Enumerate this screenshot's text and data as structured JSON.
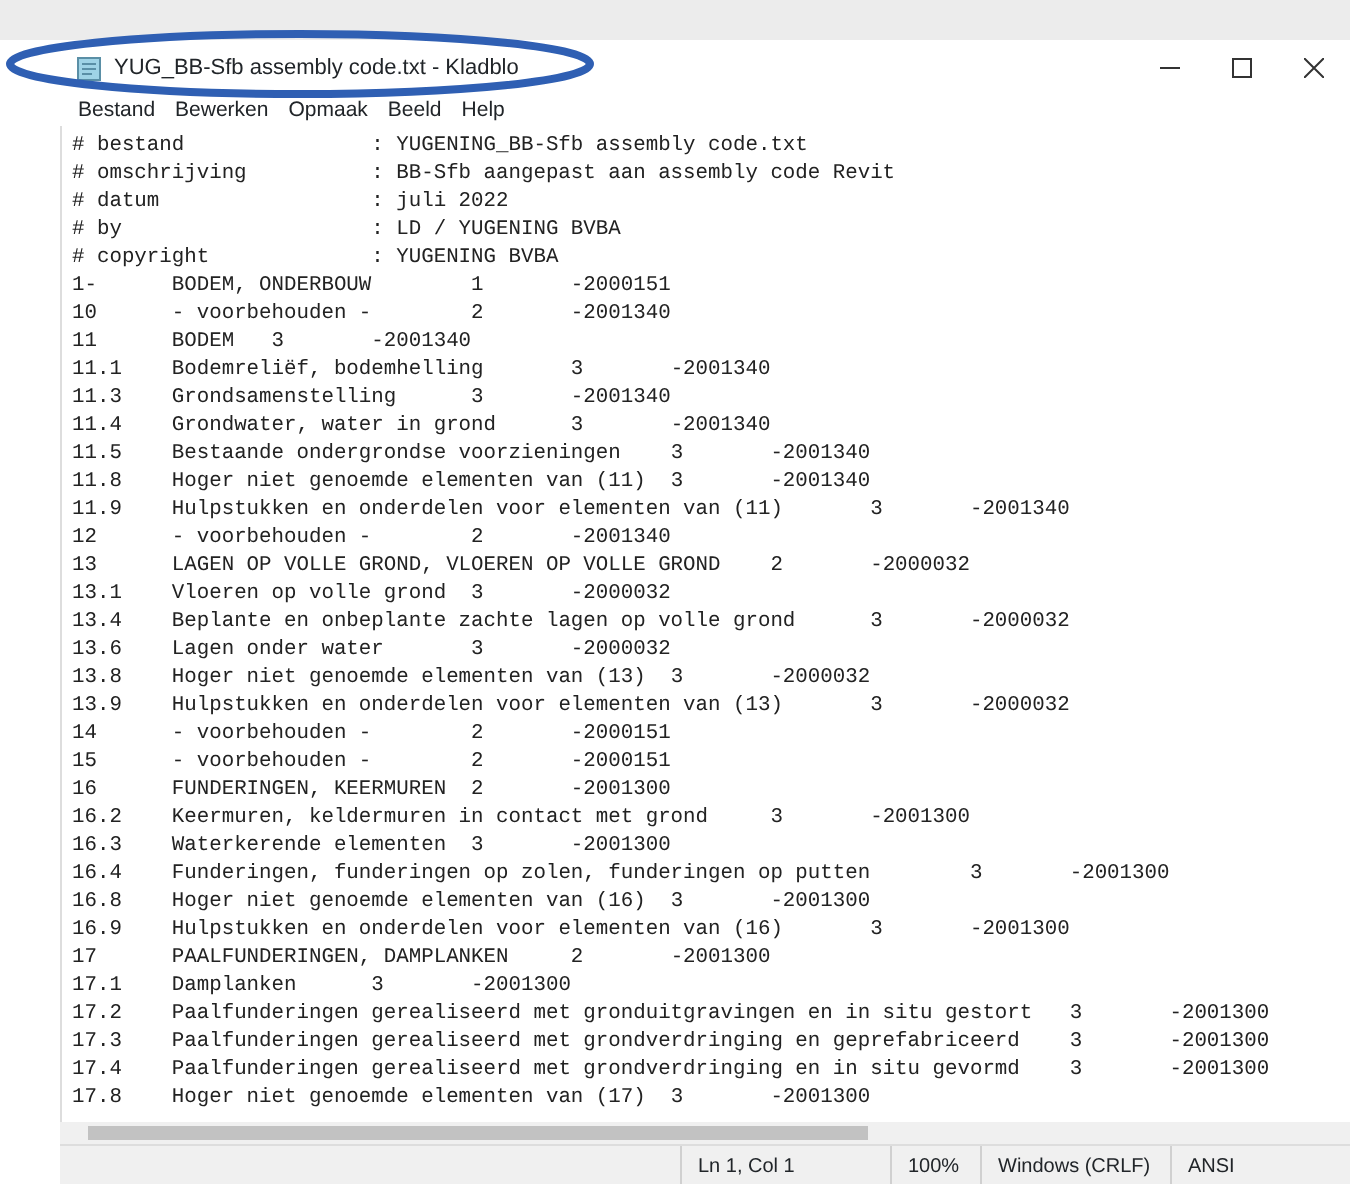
{
  "window": {
    "title": "YUG_BB-Sfb assembly code.txt - Kladblo"
  },
  "menu": [
    "Bestand",
    "Bewerken",
    "Opmaak",
    "Beeld",
    "Help"
  ],
  "lines": [
    "# bestand\t\t: YUGENING_BB-Sfb assembly code.txt",
    "# omschrijving\t\t: BB-Sfb aangepast aan assembly code Revit",
    "# datum\t\t\t: juli 2022",
    "# by\t\t\t: LD / YUGENING BVBA",
    "# copyright\t\t: YUGENING BVBA",
    "1-\tBODEM, ONDERBOUW\t1\t-2000151",
    "10\t- voorbehouden -\t2\t-2001340",
    "11\tBODEM\t3\t-2001340",
    "11.1\tBodemreliëf, bodemhelling\t3\t-2001340",
    "11.3\tGrondsamenstelling\t3\t-2001340",
    "11.4\tGrondwater, water in grond\t3\t-2001340",
    "11.5\tBestaande ondergrondse voorzieningen\t3\t-2001340",
    "11.8\tHoger niet genoemde elementen van (11)\t3\t-2001340",
    "11.9\tHulpstukken en onderdelen voor elementen van (11)\t3\t-2001340",
    "12\t- voorbehouden -\t2\t-2001340",
    "13\tLAGEN OP VOLLE GROND, VLOEREN OP VOLLE GROND\t2\t-2000032",
    "13.1\tVloeren op volle grond\t3\t-2000032",
    "13.4\tBeplante en onbeplante zachte lagen op volle grond\t3\t-2000032",
    "13.6\tLagen onder water\t3\t-2000032",
    "13.8\tHoger niet genoemde elementen van (13)\t3\t-2000032",
    "13.9\tHulpstukken en onderdelen voor elementen van (13)\t3\t-2000032",
    "14\t- voorbehouden -\t2\t-2000151",
    "15\t- voorbehouden -\t2\t-2000151",
    "16\tFUNDERINGEN, KEERMUREN\t2\t-2001300",
    "16.2\tKeermuren, keldermuren in contact met grond\t3\t-2001300",
    "16.3\tWaterkerende elementen\t3\t-2001300",
    "16.4\tFunderingen, funderingen op zolen, funderingen op putten\t3\t-2001300",
    "16.8\tHoger niet genoemde elementen van (16)\t3\t-2001300",
    "16.9\tHulpstukken en onderdelen voor elementen van (16)\t3\t-2001300",
    "17\tPAALFUNDERINGEN, DAMPLANKEN\t2\t-2001300",
    "17.1\tDamplanken\t3\t-2001300",
    "17.2\tPaalfunderingen gerealiseerd met gronduitgravingen en in situ gestort\t3\t-2001300",
    "17.3\tPaalfunderingen gerealiseerd met grondverdringing en geprefabriceerd\t3\t-2001300",
    "17.4\tPaalfunderingen gerealiseerd met grondverdringing en in situ gevormd\t3\t-2001300",
    "17.8\tHoger niet genoemde elementen van (17)\t3\t-2001300"
  ],
  "status_bar": [
    "Ln 1, Col 1",
    "100%",
    "Windows (CRLF)",
    "ANSI"
  ]
}
